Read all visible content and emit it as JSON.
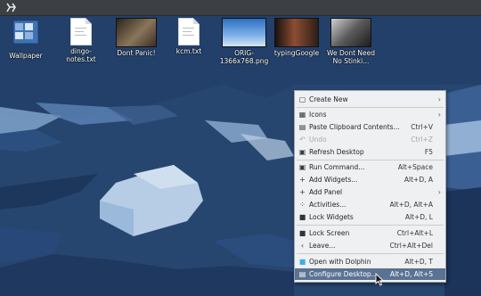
{
  "desktop": {
    "icons": [
      {
        "label": "Wallpaper",
        "kind": "folder",
        "colors": {
          "bg": "#3f72b5"
        }
      },
      {
        "label": "dingo-notes.txt",
        "kind": "text"
      },
      {
        "label": "Dont Panic!",
        "kind": "image",
        "colors": {
          "bg": "#6a5a43"
        }
      },
      {
        "label": "kcm.txt",
        "kind": "text"
      },
      {
        "label": "ORIG-1366x768.png",
        "kind": "image",
        "colors": {
          "bg": "#4c8ed6"
        }
      },
      {
        "label": "typingGoogle",
        "kind": "image",
        "colors": {
          "bg": "#2a1d17"
        }
      },
      {
        "label": "We Dont Need No Stinki...",
        "kind": "image",
        "colors": {
          "bg": "#6e6e6e"
        }
      }
    ]
  },
  "context_menu": {
    "items": [
      {
        "label": "Create New",
        "shortcut": "",
        "submenu": true,
        "icon": "document-new-icon",
        "disabled": false
      },
      {
        "separator": true
      },
      {
        "label": "Icons",
        "shortcut": "",
        "submenu": true,
        "icon": "icons-view-icon",
        "disabled": false
      },
      {
        "label": "Paste Clipboard Contents...",
        "shortcut": "Ctrl+V",
        "submenu": false,
        "icon": "paste-icon",
        "disabled": false
      },
      {
        "label": "Undo",
        "shortcut": "Ctrl+Z",
        "submenu": false,
        "icon": "undo-icon",
        "disabled": true
      },
      {
        "label": "Refresh Desktop",
        "shortcut": "F5",
        "submenu": false,
        "icon": "refresh-icon",
        "disabled": false
      },
      {
        "separator": true
      },
      {
        "label": "Run Command...",
        "shortcut": "Alt+Space",
        "submenu": false,
        "icon": "run-command-icon",
        "disabled": false
      },
      {
        "label": "Add Widgets...",
        "shortcut": "Alt+D, A",
        "submenu": false,
        "icon": "plus-icon",
        "disabled": false
      },
      {
        "label": "Add Panel",
        "shortcut": "",
        "submenu": true,
        "icon": "plus-icon",
        "disabled": false
      },
      {
        "label": "Activities...",
        "shortcut": "Alt+D, Alt+A",
        "submenu": false,
        "icon": "activities-icon",
        "disabled": false
      },
      {
        "label": "Lock Widgets",
        "shortcut": "Alt+D, L",
        "submenu": false,
        "icon": "lock-icon",
        "disabled": false
      },
      {
        "separator": true
      },
      {
        "label": "Lock Screen",
        "shortcut": "Ctrl+Alt+L",
        "submenu": false,
        "icon": "lock-icon",
        "disabled": false
      },
      {
        "label": "Leave...",
        "shortcut": "Ctrl+Alt+Del",
        "submenu": false,
        "icon": "leave-icon",
        "disabled": false
      },
      {
        "separator": true
      },
      {
        "label": "Open with Dolphin",
        "shortcut": "Alt+D, T",
        "submenu": false,
        "icon": "folder-icon",
        "disabled": false
      },
      {
        "label": "Configure Desktop...",
        "shortcut": "Alt+D, Alt+S",
        "submenu": false,
        "icon": "configure-icon",
        "disabled": false,
        "active": true
      }
    ]
  },
  "colors": {
    "topbar": "#3c3f43",
    "menu_bg": "#eff0f1",
    "menu_highlight": "#5b7393",
    "wall_dark": "#20385c",
    "wall_mid": "#2f568a",
    "wall_light": "#a9c4e1"
  }
}
